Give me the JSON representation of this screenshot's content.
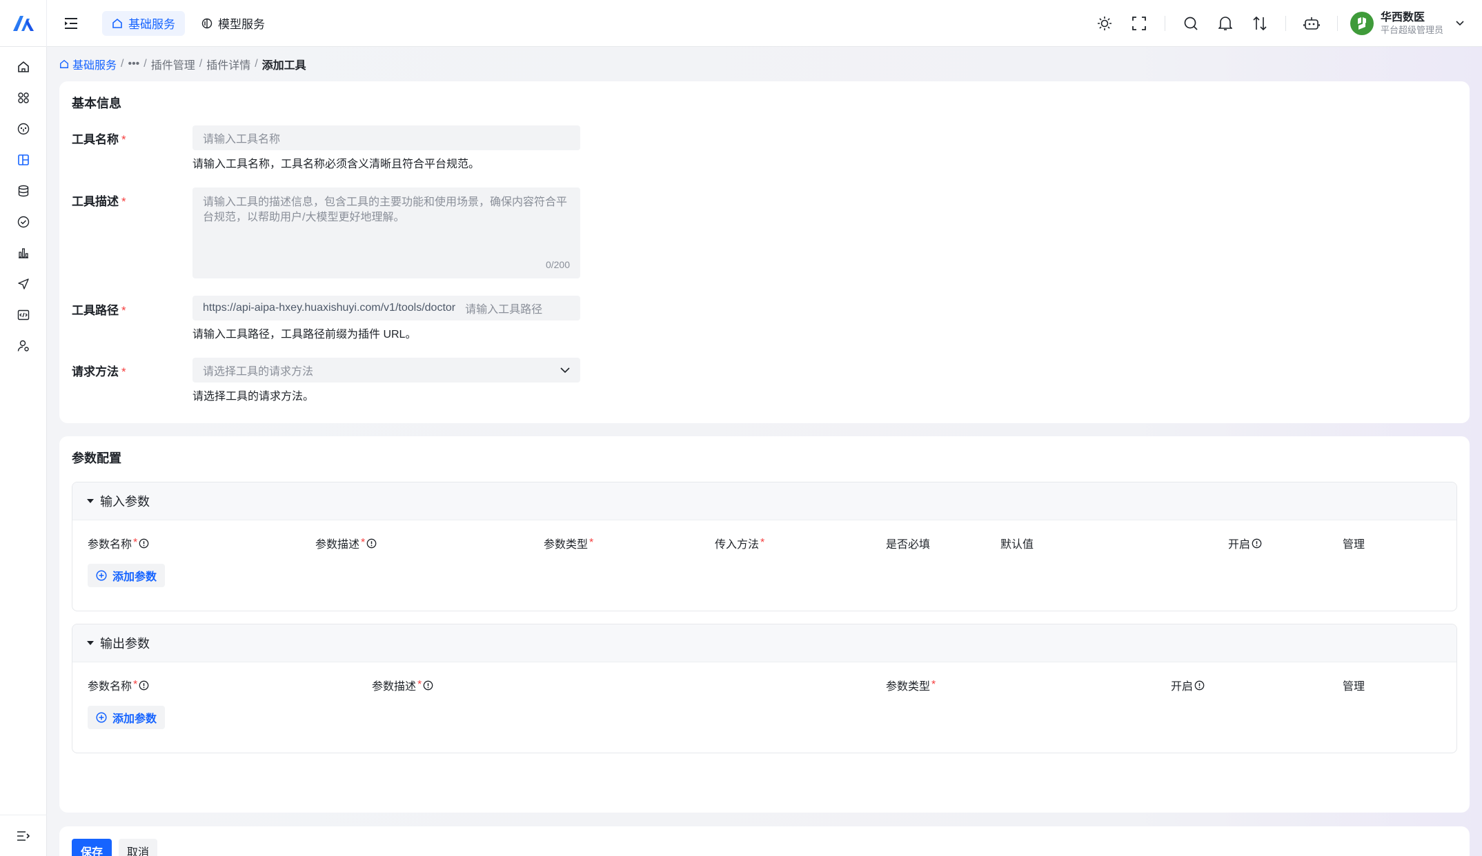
{
  "topnav": {
    "tabs": [
      {
        "label": "基础服务",
        "icon": "home-icon",
        "active": true
      },
      {
        "label": "模型服务",
        "icon": "model-icon",
        "active": false
      }
    ]
  },
  "toolbar": {
    "icons": [
      "sun-icon",
      "fullscreen-icon",
      "search-icon",
      "bell-icon",
      "sort-arrows-icon",
      "robot-icon"
    ]
  },
  "user": {
    "name": "华西数医",
    "role": "平台超级管理员"
  },
  "sidebar": {
    "icons": [
      "home-icon",
      "apps-icon",
      "dashboard-icon",
      "layout-icon",
      "database-icon",
      "check-circle-icon",
      "bar-chart-icon",
      "send-icon",
      "code-icon",
      "user-settings-icon"
    ]
  },
  "breadcrumb": {
    "home": "基础服务",
    "ellipsis": "•••",
    "items": [
      "插件管理",
      "插件详情"
    ],
    "current": "添加工具",
    "separator": "/"
  },
  "basic": {
    "title": "基本信息",
    "name_label": "工具名称",
    "name_placeholder": "请输入工具名称",
    "name_help": "请输入工具名称，工具名称必须含义清晰且符合平台规范。",
    "desc_label": "工具描述",
    "desc_placeholder": "请输入工具的描述信息，包含工具的主要功能和使用场景，确保内容符合平台规范，以帮助用户/大模型更好地理解。",
    "desc_counter": "0/200",
    "path_label": "工具路径",
    "path_prefix": "https://api-aipa-hxey.huaxishuyi.com/v1/tools/doctor",
    "path_placeholder": "请输入工具路径",
    "path_help": "请输入工具路径，工具路径前缀为插件 URL。",
    "method_label": "请求方法",
    "method_placeholder": "请选择工具的请求方法",
    "method_help": "请选择工具的请求方法。",
    "required_mark": "*"
  },
  "params": {
    "title": "参数配置",
    "input": {
      "title": "输入参数",
      "columns": [
        "参数名称",
        "参数描述",
        "参数类型",
        "传入方法",
        "是否必填",
        "默认值",
        "开启",
        "管理"
      ],
      "add_label": "添加参数"
    },
    "output": {
      "title": "输出参数",
      "columns": [
        "参数名称",
        "参数描述",
        "参数类型",
        "开启",
        "管理"
      ],
      "add_label": "添加参数"
    }
  },
  "actions": {
    "save": "保存",
    "cancel": "取消"
  },
  "colors": {
    "primary": "#1664ff",
    "required": "#f53f3f",
    "avatar": "#3f9b3a"
  }
}
